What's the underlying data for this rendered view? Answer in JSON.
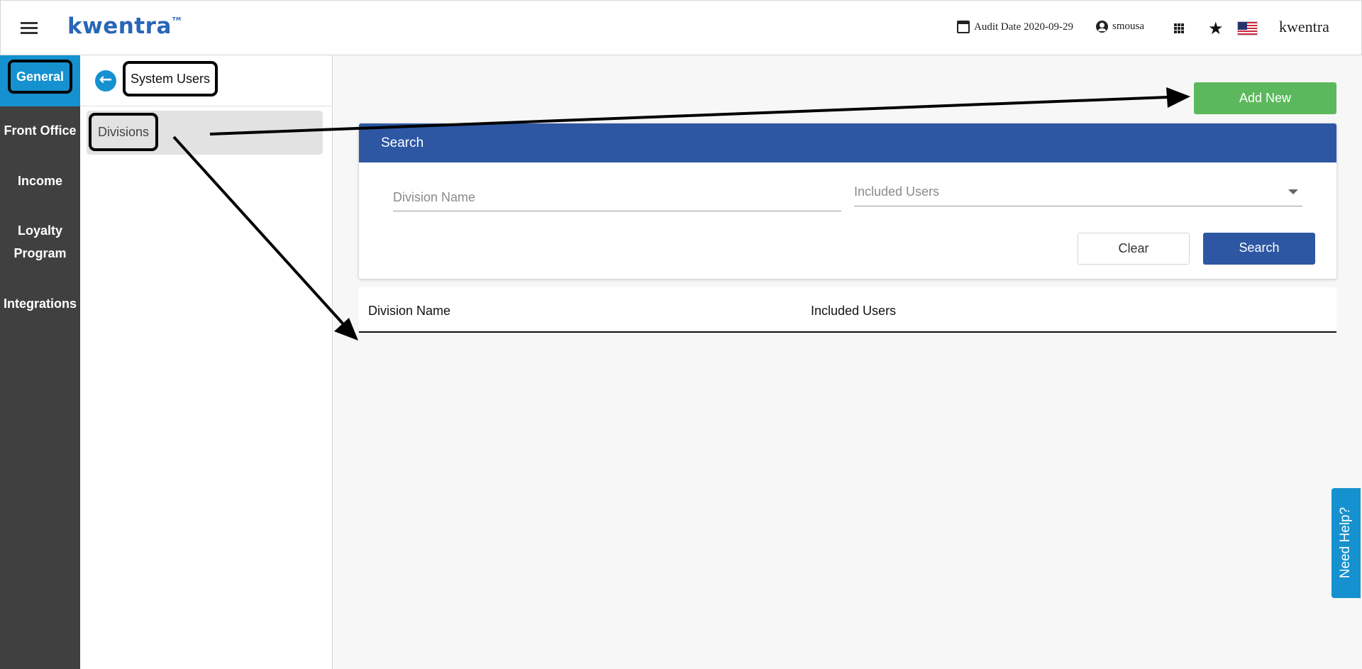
{
  "header": {
    "logo": "kwentra",
    "logo_tm": "TM",
    "audit_date": "Audit Date 2020-09-29",
    "username": "smousa",
    "brand": "kwentra"
  },
  "rail": {
    "items": [
      {
        "label": "General",
        "active": true
      },
      {
        "label": "Front Office"
      },
      {
        "label": "Income"
      },
      {
        "label": "Loyalty Program"
      },
      {
        "label": "Integrations"
      }
    ]
  },
  "submenu": {
    "title": "System Users",
    "items": [
      {
        "label": "Divisions"
      }
    ]
  },
  "main": {
    "add_button": "Add New",
    "search_panel": {
      "title": "Search",
      "division_name_placeholder": "Division Name",
      "included_users_placeholder": "Included Users",
      "clear_button": "Clear",
      "search_button": "Search"
    },
    "table": {
      "columns": [
        "Division Name",
        "Included Users"
      ]
    }
  },
  "help_tab": "Need Help?",
  "colors": {
    "brand_blue": "#2a66b6",
    "header_blue": "#2d57a3",
    "accent_cyan": "#1591cf",
    "add_green": "#5cb85c",
    "rail_dark": "#404040"
  }
}
